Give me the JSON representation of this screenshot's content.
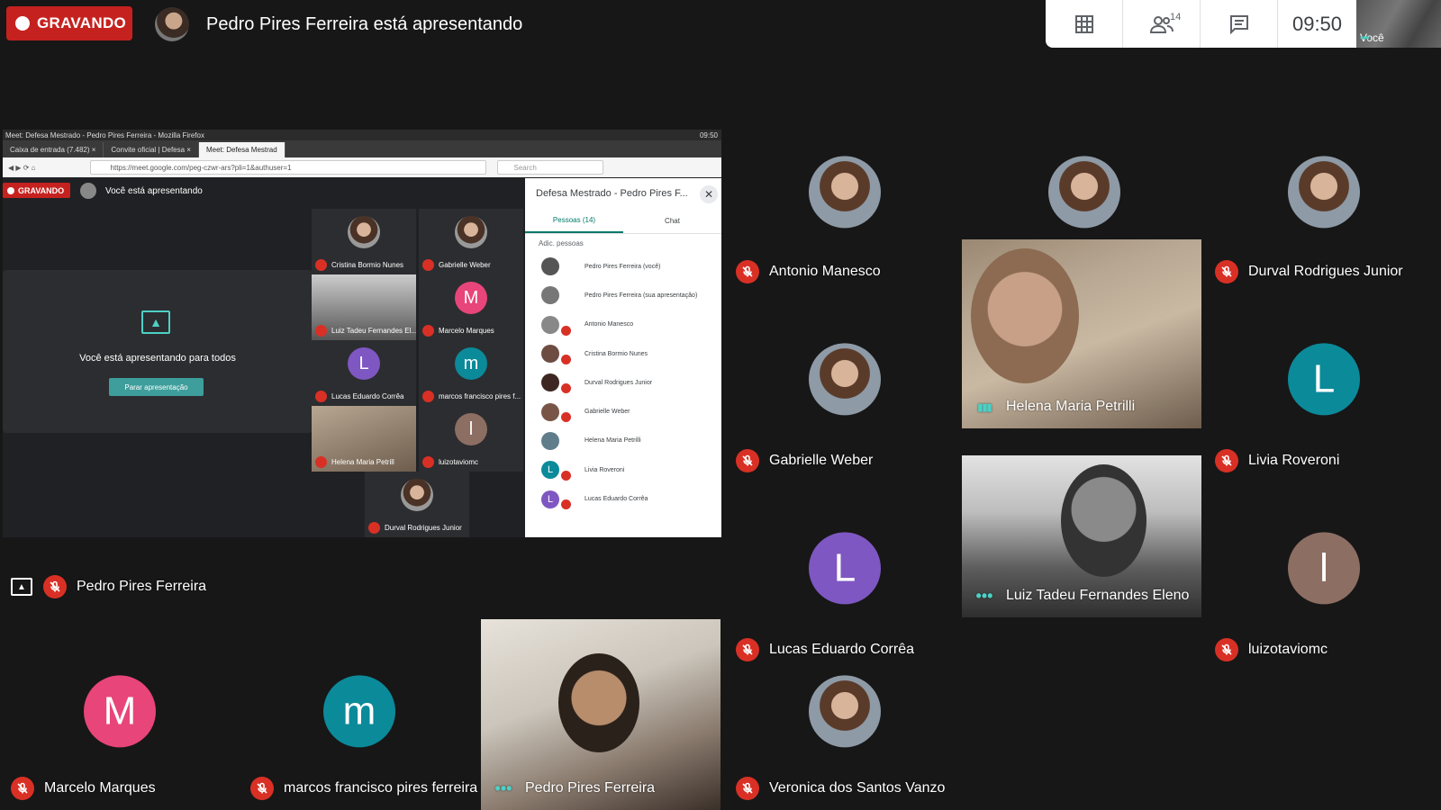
{
  "topbar": {
    "recording_label": "GRAVANDO",
    "presenting_text": "Pedro Pires Ferreira está apresentando",
    "participant_count": "14",
    "clock": "09:50",
    "self_label": "Você"
  },
  "colors": {
    "mute": "#d93025",
    "record": "#c5221f",
    "teal": "#4dd0c5"
  },
  "tiles": [
    {
      "name": "Antonio Manesco",
      "state": "muted",
      "avatar": "photo"
    },
    {
      "name": "Cristina Bormio Nunes",
      "state": "muted",
      "avatar": "photo"
    },
    {
      "name": "Durval Rodrigues Junior",
      "state": "muted",
      "avatar": "photo"
    },
    {
      "name": "Gabrielle Weber",
      "state": "muted",
      "avatar": "photo"
    },
    {
      "name": "Helena Maria Petrilli",
      "state": "speaking",
      "avatar": "video"
    },
    {
      "name": "Livia Roveroni",
      "state": "muted",
      "avatar": "L",
      "color": "#0b8a9a"
    },
    {
      "name": "Lucas Eduardo Corrêa",
      "state": "muted",
      "avatar": "L",
      "color": "#7e57c2"
    },
    {
      "name": "Luiz Tadeu Fernandes Eleno",
      "state": "dots",
      "avatar": "video"
    },
    {
      "name": "luizotaviomc",
      "state": "muted",
      "avatar": "l",
      "color": "#8d6e63"
    },
    {
      "name": "Pedro Pires Ferreira",
      "state": "presenting",
      "avatar": "screen"
    },
    {
      "name": "Marcelo Marques",
      "state": "muted",
      "avatar": "M",
      "color": "#e8457a"
    },
    {
      "name": "marcos francisco pires ferreira",
      "state": "muted",
      "avatar": "m",
      "color": "#0b8a9a"
    },
    {
      "name": "Pedro Pires Ferreira",
      "state": "dots",
      "avatar": "video"
    },
    {
      "name": "Veronica dos Santos Vanzo",
      "state": "muted",
      "avatar": "photo"
    }
  ],
  "share": {
    "window_title": "Meet: Defesa Mestrado - Pedro Pires Ferreira - Mozilla Firefox",
    "tray_time": "09:50",
    "tabs": [
      "Caixa de entrada (7.482)",
      "Convite oficial | Defesa",
      "Meet: Defesa Mestrad"
    ],
    "url": "https://meet.google.com/peg-czwr-ars?pli=1&authuser=1",
    "search_placeholder": "Search",
    "inner_rec": "GRAVANDO",
    "inner_presenting": "Você está apresentando",
    "card_text": "Você está apresentando para todos",
    "card_button": "Parar apresentação",
    "mini_tiles": [
      {
        "name": "Cristina Bormio Nunes",
        "avatar": "photo"
      },
      {
        "name": "Gabrielle Weber",
        "avatar": "photo"
      },
      {
        "name": "Luiz Tadeu Fernandes El...",
        "avatar": "video"
      },
      {
        "name": "Marcelo Marques",
        "avatar": "M",
        "color": "#e8457a"
      },
      {
        "name": "Lucas Eduardo Corrêa",
        "avatar": "L",
        "color": "#7e57c2"
      },
      {
        "name": "marcos francisco pires f...",
        "avatar": "m",
        "color": "#0b8a9a"
      },
      {
        "name": "Helena Maria Petrill",
        "avatar": "video"
      },
      {
        "name": "luizotaviomc",
        "avatar": "l",
        "color": "#8d6e63"
      },
      {
        "name": "Durval Rodrigues Junior",
        "avatar": "photo"
      }
    ],
    "panel_title": "Defesa Mestrado - Pedro Pires F...",
    "tab_people": "Pessoas (14)",
    "tab_chat": "Chat",
    "add_people": "Adic. pessoas",
    "people": [
      "Pedro Pires Ferreira (você)",
      "Pedro Pires Ferreira (sua apresentação)",
      "Antonio Manesco",
      "Cristina Bormio Nunes",
      "Durval Rodrigues Junior",
      "Gabrielle Weber",
      "Helena Maria Petrilli",
      "Livia Roveroni",
      "Lucas Eduardo Corrêa"
    ]
  }
}
